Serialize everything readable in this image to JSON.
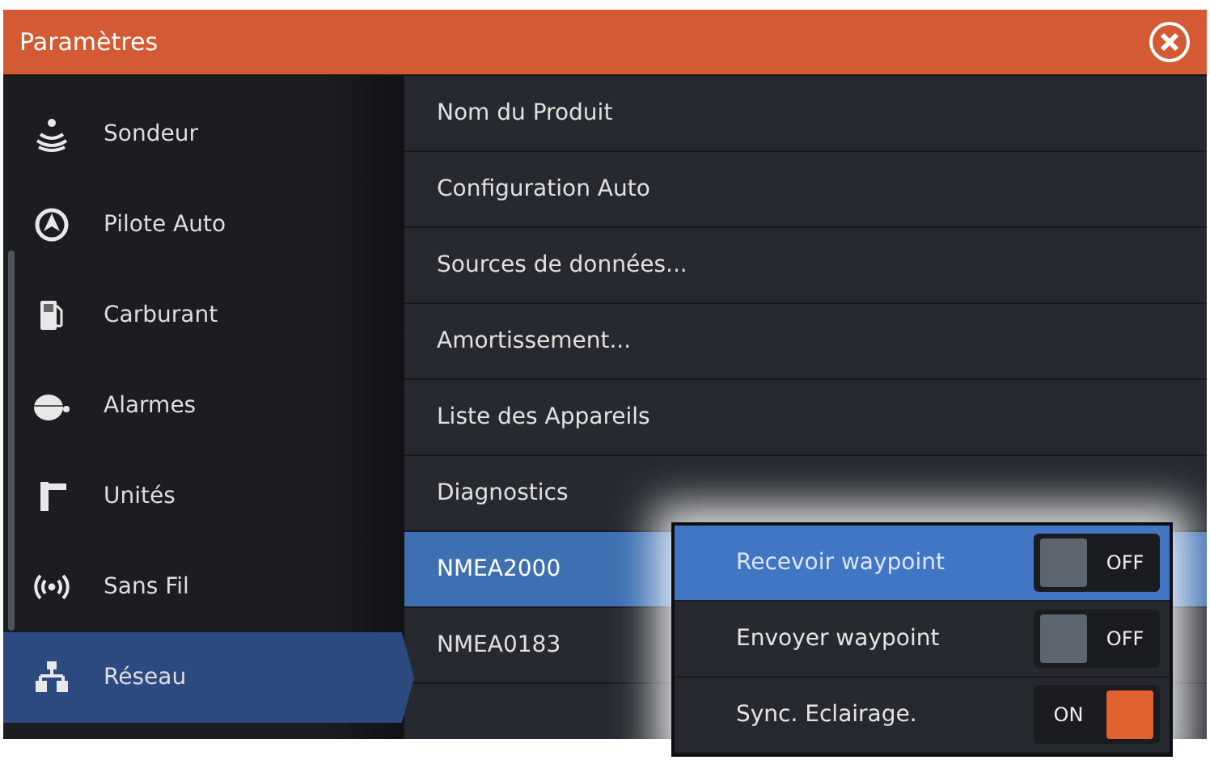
{
  "window": {
    "title": "Paramètres"
  },
  "sidebar": {
    "items": [
      {
        "label": "Sondeur",
        "kind": "sonar",
        "selected": false
      },
      {
        "label": "Pilote Auto",
        "kind": "autopilot",
        "selected": false
      },
      {
        "label": "Carburant",
        "kind": "fuel",
        "selected": false
      },
      {
        "label": "Alarmes",
        "kind": "bell",
        "selected": false
      },
      {
        "label": "Unités",
        "kind": "ruler",
        "selected": false
      },
      {
        "label": "Sans Fil",
        "kind": "wireless",
        "selected": false
      },
      {
        "label": "Réseau",
        "kind": "network",
        "selected": true
      }
    ]
  },
  "menu": {
    "items": [
      {
        "label": "Nom du Produit",
        "selected": false
      },
      {
        "label": "Configuration Auto",
        "selected": false
      },
      {
        "label": "Sources de données...",
        "selected": false
      },
      {
        "label": "Amortissement...",
        "selected": false
      },
      {
        "label": "Liste des Appareils",
        "selected": false
      },
      {
        "label": "Diagnostics",
        "selected": false
      },
      {
        "label": "NMEA2000",
        "selected": true
      },
      {
        "label": "NMEA0183",
        "selected": false
      }
    ]
  },
  "popup": {
    "items": [
      {
        "label": "Recevoir waypoint",
        "selected": true,
        "on": false,
        "state_text": "OFF"
      },
      {
        "label": "Envoyer waypoint",
        "selected": false,
        "on": false,
        "state_text": "OFF"
      },
      {
        "label": "Sync. Eclairage.",
        "selected": false,
        "on": true,
        "state_text": "ON"
      }
    ]
  }
}
